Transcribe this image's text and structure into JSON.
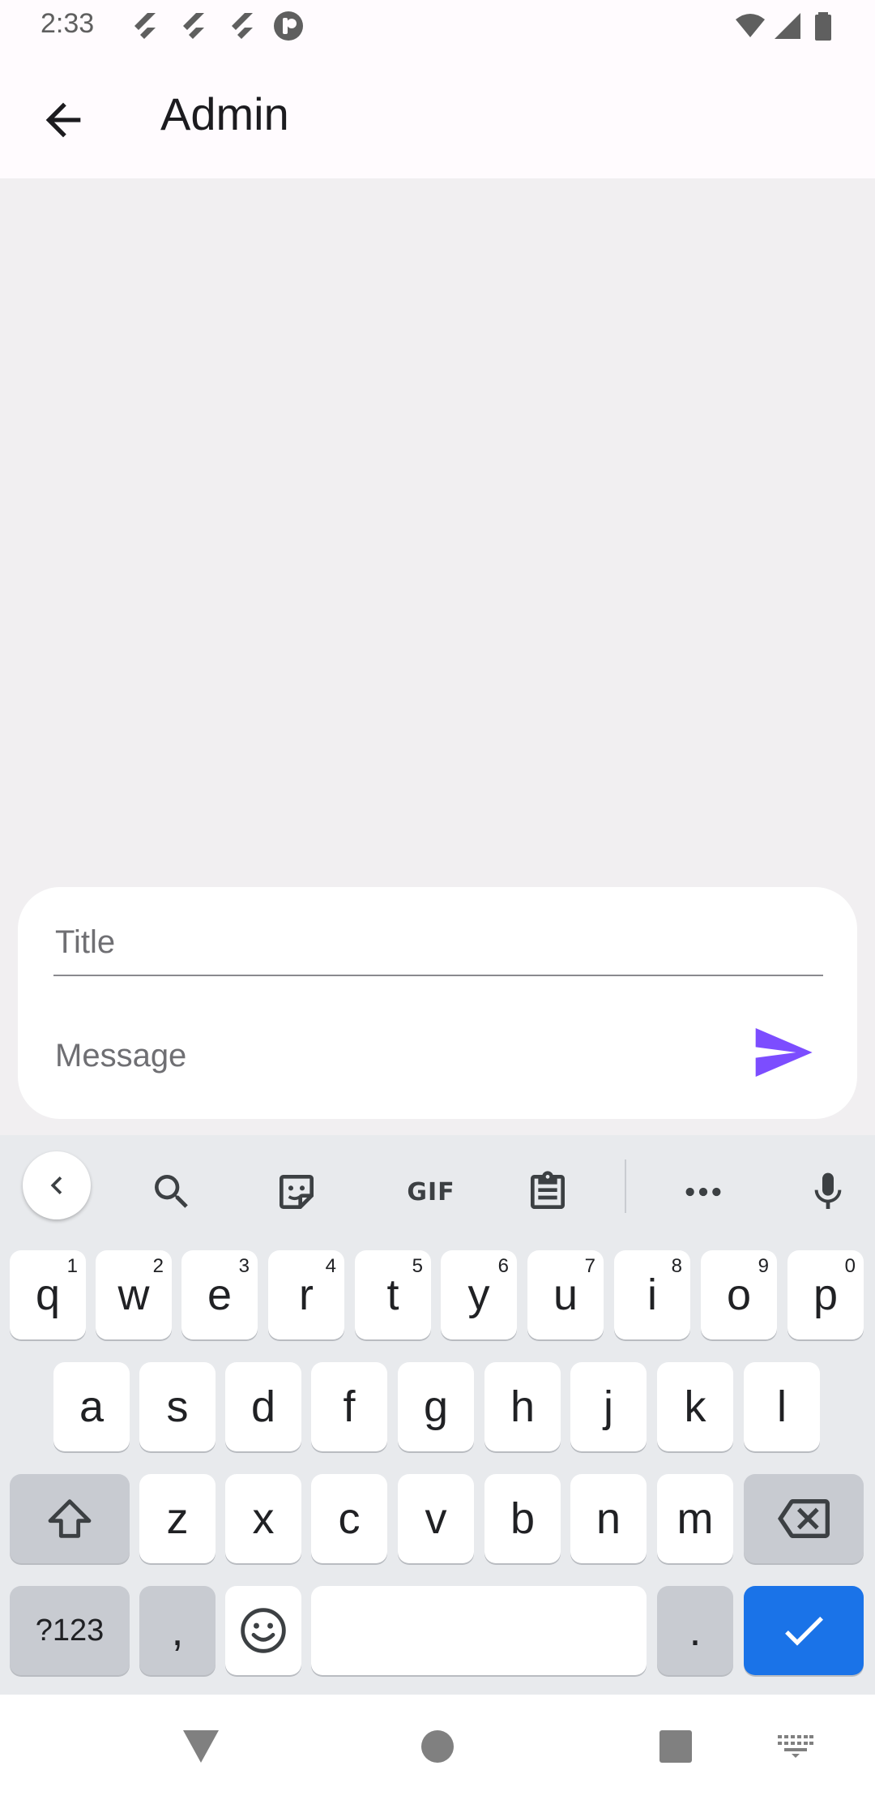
{
  "status_bar": {
    "time": "2:33",
    "left_icons": [
      "flutter-icon",
      "flutter-icon",
      "flutter-icon",
      "app-notification-icon"
    ],
    "right_icons": [
      "wifi-icon",
      "signal-icon",
      "battery-icon"
    ]
  },
  "app_bar": {
    "back_icon": "arrow-left-icon",
    "title": "Admin"
  },
  "composer": {
    "title_placeholder": "Title",
    "title_value": "",
    "message_placeholder": "Message",
    "message_value": "",
    "send_icon": "send-icon",
    "accent_color": "#7c4dff"
  },
  "keyboard": {
    "toolbar": {
      "collapse_icon": "chevron-left-icon",
      "search_icon": "search-icon",
      "sticker_icon": "sticker-icon",
      "gif_label": "GIF",
      "clipboard_icon": "clipboard-icon",
      "more_icon": "more-horizontal-icon",
      "mic_icon": "microphone-icon"
    },
    "row1": [
      {
        "label": "q",
        "hint": "1"
      },
      {
        "label": "w",
        "hint": "2"
      },
      {
        "label": "e",
        "hint": "3"
      },
      {
        "label": "r",
        "hint": "4"
      },
      {
        "label": "t",
        "hint": "5"
      },
      {
        "label": "y",
        "hint": "6"
      },
      {
        "label": "u",
        "hint": "7"
      },
      {
        "label": "i",
        "hint": "8"
      },
      {
        "label": "o",
        "hint": "9"
      },
      {
        "label": "p",
        "hint": "0"
      }
    ],
    "row2": [
      "a",
      "s",
      "d",
      "f",
      "g",
      "h",
      "j",
      "k",
      "l"
    ],
    "row3": [
      "z",
      "x",
      "c",
      "v",
      "b",
      "n",
      "m"
    ],
    "symbols_label": "?123",
    "comma_label": ",",
    "period_label": ".",
    "space_label": "",
    "shift_icon": "shift-icon",
    "backspace_icon": "backspace-icon",
    "emoji_icon": "emoji-icon",
    "enter_icon": "check-icon",
    "enter_color": "#1a73e8"
  },
  "nav_bar": {
    "back_icon": "nav-back-triangle-icon",
    "home_icon": "nav-home-circle-icon",
    "recents_icon": "nav-recents-square-icon",
    "keyboard_icon": "keyboard-switch-icon"
  }
}
